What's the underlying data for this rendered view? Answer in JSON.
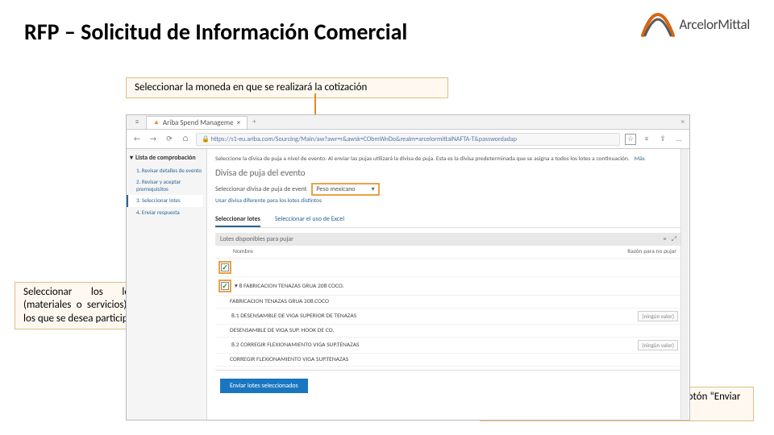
{
  "title": "RFP – Solicitud de Información Comercial",
  "brand": {
    "name": "ArcelorMittal"
  },
  "callouts": {
    "top": "Seleccionar la moneda en que se realizará la cotización",
    "left": "Seleccionar los lotes (materiales o servicios) en los que se desea participar",
    "right": "Una vez seleccionados los lotes, dar clic en el botón “Enviar lotes seleccionados”."
  },
  "browser": {
    "tab_label": "Ariba Spend Manageme",
    "url": "https://s1-eu.ariba.com/Sourcing/Main/aw?awr=r&awsk=CObmWnDo&realm=arcelormittalNAFTA-T&passwordadap",
    "close": "×",
    "icons": {
      "menu": "≡",
      "back": "←",
      "fwd": "→",
      "reload": "⟳",
      "home": "⌂",
      "lock": "🔒",
      "star": "☆",
      "share": "⇪",
      "more": "…",
      "book": "≡"
    }
  },
  "sidebar": {
    "header": "Lista de comprobación",
    "chev": "▾",
    "items": [
      "1. Revisar detalles de evento",
      "2. Revisar y aceptar prerrequisitos",
      "3. Seleccionar lotes",
      "4. Enviar respuesta"
    ]
  },
  "main": {
    "banner_text": "Seleccione la divisa de puja a nivel de evento. Al enviar las pujas utilizará la divisa de puja. Esta es la divisa predeterminada que se asigna a todos los lotes a continuación.",
    "banner_more": "Más",
    "section": "Divisa de puja del evento",
    "field_label": "Seleccionar divisa de puja de event",
    "currency": "Peso mexicano",
    "sublink": "Usar divisa diferente para los lotes distintos",
    "tabs": {
      "a": "Seleccionar lotes",
      "b": "Seleccionar el uso de Excel"
    },
    "lots_label": "Lotes disponibles para pujar",
    "col_a": "Nombre",
    "col_b": "Razón para no pujar",
    "chev_d": "▾",
    "menu_ic": "≡",
    "exp_ic": "⤢",
    "lots": [
      {
        "code": "▾ 8  FABRICACION TENAZAS GRUA 208 COCO.",
        "sub": "FABRICACION TENAZAS GRUA 208.COCO",
        "checked": true
      },
      {
        "code": "8.1  DESENSAMBLE DE VIGA SUPERIOR DE TENAZAS",
        "sub": "DESENSAMBLE DE VIGA SUP. HOOK DE CO.",
        "val": "(ningún valor)"
      },
      {
        "code": "8.2  CORREGIR FLEXIONAMIENTO VIGA SUP.TENAZAS",
        "sub": "CORREGIR FLEXIONAMIENTO VIGA SUP.TENAZAS",
        "val": "(ningún valor)"
      }
    ],
    "submit": "Enviar lotes seleccionados"
  }
}
